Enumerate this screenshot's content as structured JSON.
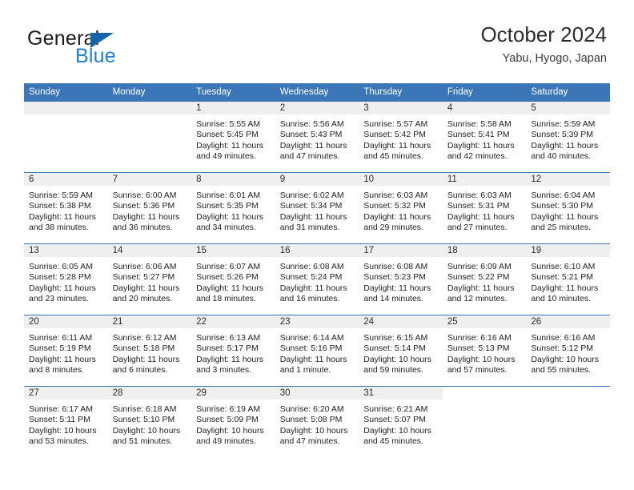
{
  "logo": {
    "word1": "General",
    "word2": "Blue",
    "triangle_color": "#1565ad",
    "blue_color": "#1f7fd0"
  },
  "header": {
    "title": "October 2024",
    "location": "Yabu, Hyogo, Japan"
  },
  "theme": {
    "header_blue": "#3b77b8",
    "daynum_bar": "#efefef"
  },
  "weekdays": [
    "Sunday",
    "Monday",
    "Tuesday",
    "Wednesday",
    "Thursday",
    "Friday",
    "Saturday"
  ],
  "labels": {
    "sunrise": "Sunrise:",
    "sunset": "Sunset:",
    "daylight": "Daylight:"
  },
  "weeks": [
    [
      {
        "day": "",
        "empty": true
      },
      {
        "day": "",
        "empty": true
      },
      {
        "day": "1",
        "sunrise": "Sunrise: 5:55 AM",
        "sunset": "Sunset: 5:45 PM",
        "daylight": "Daylight: 11 hours and 49 minutes."
      },
      {
        "day": "2",
        "sunrise": "Sunrise: 5:56 AM",
        "sunset": "Sunset: 5:43 PM",
        "daylight": "Daylight: 11 hours and 47 minutes."
      },
      {
        "day": "3",
        "sunrise": "Sunrise: 5:57 AM",
        "sunset": "Sunset: 5:42 PM",
        "daylight": "Daylight: 11 hours and 45 minutes."
      },
      {
        "day": "4",
        "sunrise": "Sunrise: 5:58 AM",
        "sunset": "Sunset: 5:41 PM",
        "daylight": "Daylight: 11 hours and 42 minutes."
      },
      {
        "day": "5",
        "sunrise": "Sunrise: 5:59 AM",
        "sunset": "Sunset: 5:39 PM",
        "daylight": "Daylight: 11 hours and 40 minutes."
      }
    ],
    [
      {
        "day": "6",
        "sunrise": "Sunrise: 5:59 AM",
        "sunset": "Sunset: 5:38 PM",
        "daylight": "Daylight: 11 hours and 38 minutes."
      },
      {
        "day": "7",
        "sunrise": "Sunrise: 6:00 AM",
        "sunset": "Sunset: 5:36 PM",
        "daylight": "Daylight: 11 hours and 36 minutes."
      },
      {
        "day": "8",
        "sunrise": "Sunrise: 6:01 AM",
        "sunset": "Sunset: 5:35 PM",
        "daylight": "Daylight: 11 hours and 34 minutes."
      },
      {
        "day": "9",
        "sunrise": "Sunrise: 6:02 AM",
        "sunset": "Sunset: 5:34 PM",
        "daylight": "Daylight: 11 hours and 31 minutes."
      },
      {
        "day": "10",
        "sunrise": "Sunrise: 6:03 AM",
        "sunset": "Sunset: 5:32 PM",
        "daylight": "Daylight: 11 hours and 29 minutes."
      },
      {
        "day": "11",
        "sunrise": "Sunrise: 6:03 AM",
        "sunset": "Sunset: 5:31 PM",
        "daylight": "Daylight: 11 hours and 27 minutes."
      },
      {
        "day": "12",
        "sunrise": "Sunrise: 6:04 AM",
        "sunset": "Sunset: 5:30 PM",
        "daylight": "Daylight: 11 hours and 25 minutes."
      }
    ],
    [
      {
        "day": "13",
        "sunrise": "Sunrise: 6:05 AM",
        "sunset": "Sunset: 5:28 PM",
        "daylight": "Daylight: 11 hours and 23 minutes."
      },
      {
        "day": "14",
        "sunrise": "Sunrise: 6:06 AM",
        "sunset": "Sunset: 5:27 PM",
        "daylight": "Daylight: 11 hours and 20 minutes."
      },
      {
        "day": "15",
        "sunrise": "Sunrise: 6:07 AM",
        "sunset": "Sunset: 5:26 PM",
        "daylight": "Daylight: 11 hours and 18 minutes."
      },
      {
        "day": "16",
        "sunrise": "Sunrise: 6:08 AM",
        "sunset": "Sunset: 5:24 PM",
        "daylight": "Daylight: 11 hours and 16 minutes."
      },
      {
        "day": "17",
        "sunrise": "Sunrise: 6:08 AM",
        "sunset": "Sunset: 5:23 PM",
        "daylight": "Daylight: 11 hours and 14 minutes."
      },
      {
        "day": "18",
        "sunrise": "Sunrise: 6:09 AM",
        "sunset": "Sunset: 5:22 PM",
        "daylight": "Daylight: 11 hours and 12 minutes."
      },
      {
        "day": "19",
        "sunrise": "Sunrise: 6:10 AM",
        "sunset": "Sunset: 5:21 PM",
        "daylight": "Daylight: 11 hours and 10 minutes."
      }
    ],
    [
      {
        "day": "20",
        "sunrise": "Sunrise: 6:11 AM",
        "sunset": "Sunset: 5:19 PM",
        "daylight": "Daylight: 11 hours and 8 minutes."
      },
      {
        "day": "21",
        "sunrise": "Sunrise: 6:12 AM",
        "sunset": "Sunset: 5:18 PM",
        "daylight": "Daylight: 11 hours and 6 minutes."
      },
      {
        "day": "22",
        "sunrise": "Sunrise: 6:13 AM",
        "sunset": "Sunset: 5:17 PM",
        "daylight": "Daylight: 11 hours and 3 minutes."
      },
      {
        "day": "23",
        "sunrise": "Sunrise: 6:14 AM",
        "sunset": "Sunset: 5:16 PM",
        "daylight": "Daylight: 11 hours and 1 minute."
      },
      {
        "day": "24",
        "sunrise": "Sunrise: 6:15 AM",
        "sunset": "Sunset: 5:14 PM",
        "daylight": "Daylight: 10 hours and 59 minutes."
      },
      {
        "day": "25",
        "sunrise": "Sunrise: 6:16 AM",
        "sunset": "Sunset: 5:13 PM",
        "daylight": "Daylight: 10 hours and 57 minutes."
      },
      {
        "day": "26",
        "sunrise": "Sunrise: 6:16 AM",
        "sunset": "Sunset: 5:12 PM",
        "daylight": "Daylight: 10 hours and 55 minutes."
      }
    ],
    [
      {
        "day": "27",
        "sunrise": "Sunrise: 6:17 AM",
        "sunset": "Sunset: 5:11 PM",
        "daylight": "Daylight: 10 hours and 53 minutes."
      },
      {
        "day": "28",
        "sunrise": "Sunrise: 6:18 AM",
        "sunset": "Sunset: 5:10 PM",
        "daylight": "Daylight: 10 hours and 51 minutes."
      },
      {
        "day": "29",
        "sunrise": "Sunrise: 6:19 AM",
        "sunset": "Sunset: 5:09 PM",
        "daylight": "Daylight: 10 hours and 49 minutes."
      },
      {
        "day": "30",
        "sunrise": "Sunrise: 6:20 AM",
        "sunset": "Sunset: 5:08 PM",
        "daylight": "Daylight: 10 hours and 47 minutes."
      },
      {
        "day": "31",
        "sunrise": "Sunrise: 6:21 AM",
        "sunset": "Sunset: 5:07 PM",
        "daylight": "Daylight: 10 hours and 45 minutes."
      },
      {
        "day": "",
        "empty": true,
        "noheader": true
      },
      {
        "day": "",
        "empty": true,
        "noheader": true
      }
    ]
  ]
}
